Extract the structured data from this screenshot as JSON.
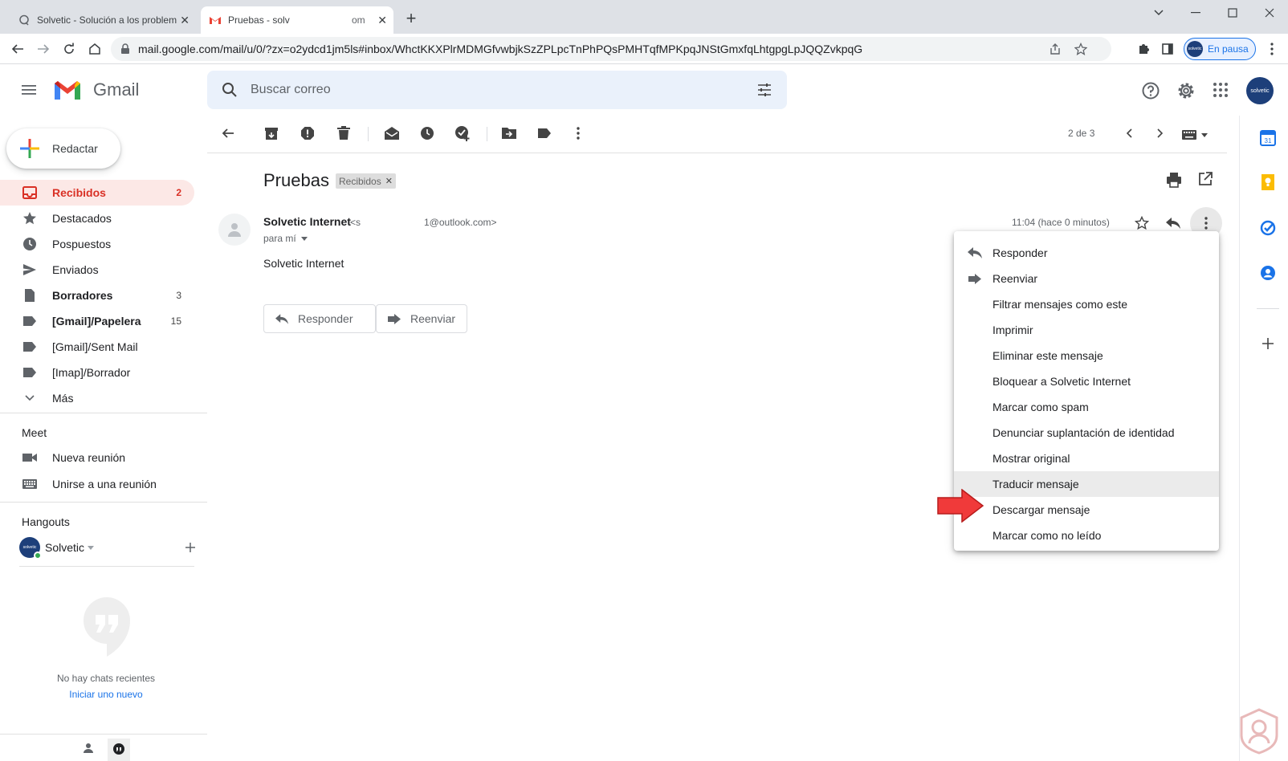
{
  "browser": {
    "tabs": [
      {
        "title": "Solvetic - Solución a los problem",
        "active": false
      },
      {
        "title": "Pruebas - solv",
        "title_tail": "om",
        "active": true
      }
    ],
    "url": "mail.google.com/mail/u/0/?zx=o2ydcd1jm5ls#inbox/WhctKKXPlrMDMGfvwbjkSzZPLpcTnPhPQsPMHTqfMPKpqJNStGmxfqLhtgpgLpJQQZvkpqG",
    "profile_label": "En pausa",
    "avatar_text": "solvetic"
  },
  "gmail": {
    "logo_text": "Gmail",
    "search_placeholder": "Buscar correo",
    "compose_label": "Redactar",
    "account_avatar_text": "solvetic"
  },
  "sidebar": {
    "items": [
      {
        "label": "Recibidos",
        "count": "2",
        "icon": "inbox-icon",
        "selected": true
      },
      {
        "label": "Destacados",
        "count": "",
        "icon": "star-icon"
      },
      {
        "label": "Pospuestos",
        "count": "",
        "icon": "clock-icon"
      },
      {
        "label": "Enviados",
        "count": "",
        "icon": "send-icon"
      },
      {
        "label": "Borradores",
        "count": "3",
        "icon": "draft-icon",
        "bold": true
      },
      {
        "label": "[Gmail]/Papelera",
        "count": "15",
        "icon": "label-icon",
        "bold": true
      },
      {
        "label": "[Gmail]/Sent Mail",
        "count": "",
        "icon": "label-icon"
      },
      {
        "label": "[Imap]/Borrador",
        "count": "",
        "icon": "label-icon"
      },
      {
        "label": "Más",
        "count": "",
        "icon": "chevron-down-icon"
      }
    ],
    "meet": {
      "heading": "Meet",
      "items": [
        {
          "label": "Nueva reunión",
          "icon": "video-icon"
        },
        {
          "label": "Unirse a una reunión",
          "icon": "keyboard-icon"
        }
      ]
    },
    "hangouts": {
      "heading": "Hangouts",
      "user": "Solvetic",
      "avatar_text": "solvetic",
      "empty_text": "No hay chats recientes",
      "start_link": "Iniciar uno nuevo"
    }
  },
  "toolbar": {
    "pager": "2 de 3"
  },
  "message": {
    "subject": "Pruebas",
    "label_chip": "Recibidos",
    "sender_name": "Solvetic Internet",
    "sender_email_head": "<s",
    "sender_email_tail": "1@outlook.com>",
    "to_line": "para mí",
    "time": "11:04 (hace 0 minutos)",
    "body": "Solvetic Internet",
    "reply_button": "Responder",
    "forward_button": "Reenviar"
  },
  "menu": {
    "items": [
      {
        "label": "Responder",
        "icon": "reply-icon"
      },
      {
        "label": "Reenviar",
        "icon": "forward-icon"
      },
      {
        "label": "Filtrar mensajes como este",
        "icon": ""
      },
      {
        "label": "Imprimir",
        "icon": ""
      },
      {
        "label": "Eliminar este mensaje",
        "icon": ""
      },
      {
        "label": "Bloquear a Solvetic Internet",
        "icon": ""
      },
      {
        "label": "Marcar como spam",
        "icon": ""
      },
      {
        "label": "Denunciar suplantación de identidad",
        "icon": ""
      },
      {
        "label": "Mostrar original",
        "icon": ""
      },
      {
        "label": "Traducir mensaje",
        "icon": "",
        "highlighted": true
      },
      {
        "label": "Descargar mensaje",
        "icon": ""
      },
      {
        "label": "Marcar como no leído",
        "icon": ""
      }
    ]
  },
  "colors": {
    "accent_red": "#d93025",
    "selected_bg": "#fce8e6",
    "arrow_red": "#f03a3a",
    "link_blue": "#1a73e8"
  }
}
